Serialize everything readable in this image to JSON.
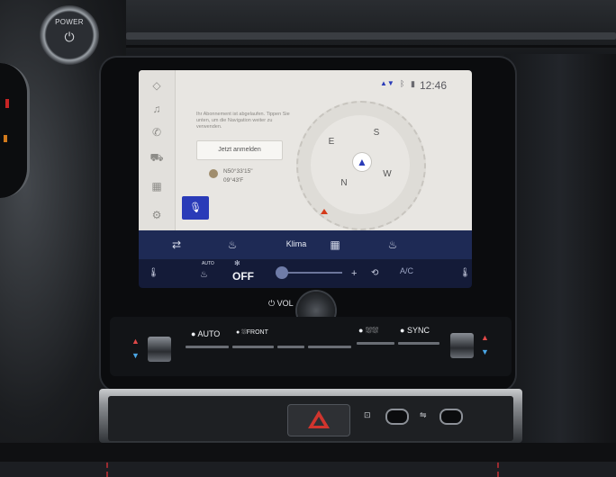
{
  "hardware": {
    "power_label": "POWER",
    "power_icon": "power-icon",
    "vol_label": "VOL",
    "auto_label": "AUTO",
    "front_label": "FRONT",
    "sync_label": "SYNC",
    "hazard_icon": "hazard-icon"
  },
  "status": {
    "time": "12:46",
    "signal": "signal-icon",
    "bluetooth": "bluetooth-icon"
  },
  "sidebar": {
    "items": [
      {
        "icon": "nav-icon"
      },
      {
        "icon": "music-icon"
      },
      {
        "icon": "phone-icon"
      },
      {
        "icon": "car-icon"
      },
      {
        "icon": "apps-icon"
      },
      {
        "icon": "settings-icon"
      }
    ]
  },
  "navigation": {
    "message": "Ihr Abonnement ist abgelaufen. Tippen Sie unten, um die Navigation weiter zu verwenden.",
    "register_button": "Jetzt anmelden",
    "coordinates_line1": "N50°33'15\"",
    "coordinates_line2": "09°43'F",
    "compass": {
      "n": "N",
      "s": "S",
      "e": "E",
      "w": "W"
    }
  },
  "menu": {
    "label": "Klima"
  },
  "climate": {
    "auto": "AUTO",
    "off": "OFF",
    "plus": "+",
    "ac": "A/C"
  },
  "colors": {
    "accent_blue": "#2a3bb8",
    "climate_bar": "#141b38",
    "menu_bar": "#1e2a55",
    "stitch_red": "#9b2b30",
    "hazard_red": "#d0352e"
  }
}
